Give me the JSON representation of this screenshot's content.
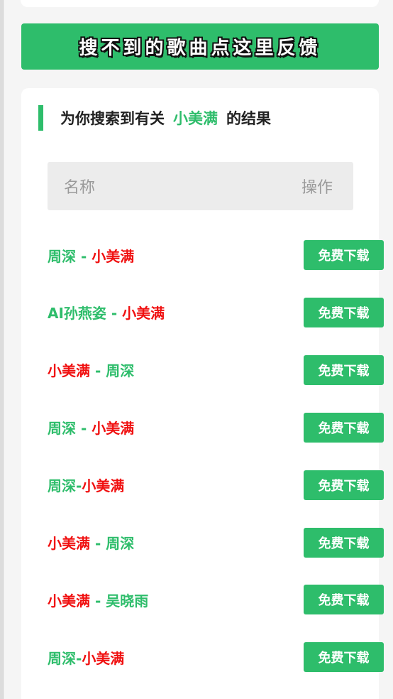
{
  "feedback": {
    "label": "搜不到的歌曲点这里反馈"
  },
  "results": {
    "heading_prefix": "为你搜索到有关",
    "keyword": "小美满",
    "heading_suffix": "的结果",
    "columns": {
      "name": "名称",
      "action": "操作"
    },
    "download_label": "免费下载",
    "items": [
      {
        "left": "周深",
        "sep": " - ",
        "right": "小美满",
        "left_role": "artist",
        "right_role": "title"
      },
      {
        "left": "AI孙燕姿",
        "sep": " - ",
        "right": "小美满",
        "left_role": "artist",
        "right_role": "title"
      },
      {
        "left": "小美满",
        "sep": " - ",
        "right": "周深",
        "left_role": "title",
        "right_role": "artist"
      },
      {
        "left": "周深",
        "sep": " - ",
        "right": "小美满",
        "left_role": "artist",
        "right_role": "title"
      },
      {
        "left": "周深",
        "sep": "-",
        "right": "小美满",
        "left_role": "artist",
        "right_role": "title"
      },
      {
        "left": "小美满",
        "sep": " - ",
        "right": "周深",
        "left_role": "title",
        "right_role": "artist"
      },
      {
        "left": "小美满",
        "sep": " - ",
        "right": "吴晓雨",
        "left_role": "title",
        "right_role": "artist"
      },
      {
        "left": "周深",
        "sep": "-",
        "right": "小美满",
        "left_role": "artist",
        "right_role": "title"
      }
    ]
  },
  "colors": {
    "accent": "#2ebd6b",
    "highlight": "#f01010"
  }
}
